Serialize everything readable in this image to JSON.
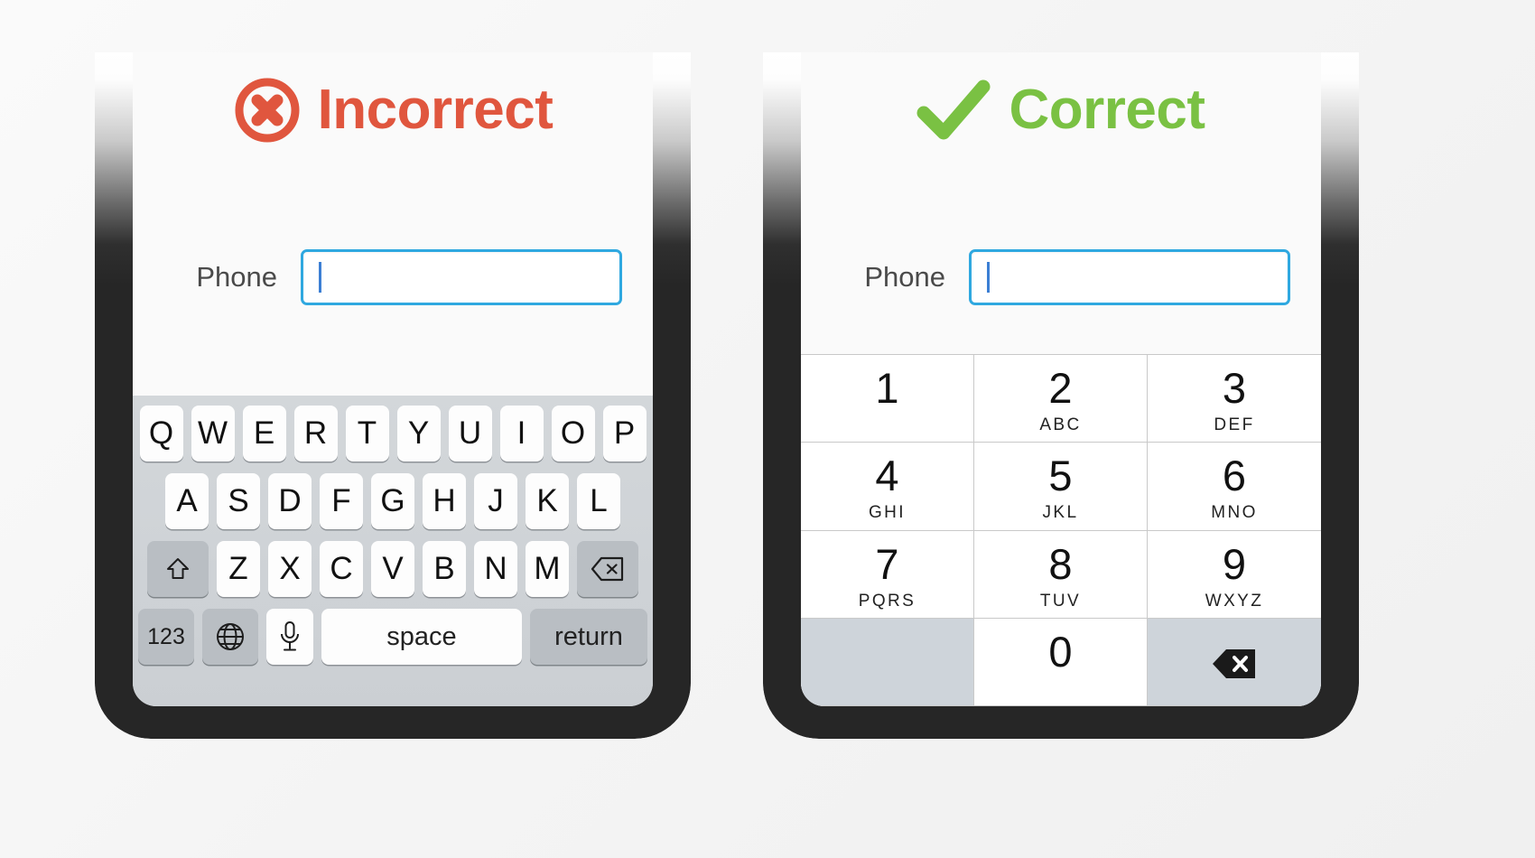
{
  "colors": {
    "incorrect": "#e0563e",
    "correct": "#7ac143",
    "input_border": "#2fa8e0",
    "caret": "#3c7fd4"
  },
  "panels": [
    {
      "id": "incorrect",
      "status_label": "Incorrect",
      "status_icon": "circle-x-icon",
      "form": {
        "label": "Phone",
        "value": "",
        "placeholder": ""
      },
      "keyboard": {
        "type": "qwerty",
        "rows": [
          [
            "Q",
            "W",
            "E",
            "R",
            "T",
            "Y",
            "U",
            "I",
            "O",
            "P"
          ],
          [
            "A",
            "S",
            "D",
            "F",
            "G",
            "H",
            "J",
            "K",
            "L"
          ],
          [
            "Z",
            "X",
            "C",
            "V",
            "B",
            "N",
            "M"
          ]
        ],
        "shift_label": "shift-icon",
        "delete_label": "delete-icon",
        "bottom_row": {
          "numbers_label": "123",
          "globe_label": "globe-icon",
          "mic_label": "mic-icon",
          "space_label": "space",
          "return_label": "return"
        }
      }
    },
    {
      "id": "correct",
      "status_label": "Correct",
      "status_icon": "check-icon",
      "form": {
        "label": "Phone",
        "value": "",
        "placeholder": ""
      },
      "keyboard": {
        "type": "numeric",
        "keys": [
          {
            "digit": "1",
            "letters": ""
          },
          {
            "digit": "2",
            "letters": "ABC"
          },
          {
            "digit": "3",
            "letters": "DEF"
          },
          {
            "digit": "4",
            "letters": "GHI"
          },
          {
            "digit": "5",
            "letters": "JKL"
          },
          {
            "digit": "6",
            "letters": "MNO"
          },
          {
            "digit": "7",
            "letters": "PQRS"
          },
          {
            "digit": "8",
            "letters": "TUV"
          },
          {
            "digit": "9",
            "letters": "WXYZ"
          },
          {
            "digit": "",
            "letters": ""
          },
          {
            "digit": "0",
            "letters": ""
          },
          {
            "digit": "delete-icon",
            "letters": ""
          }
        ]
      }
    }
  ]
}
